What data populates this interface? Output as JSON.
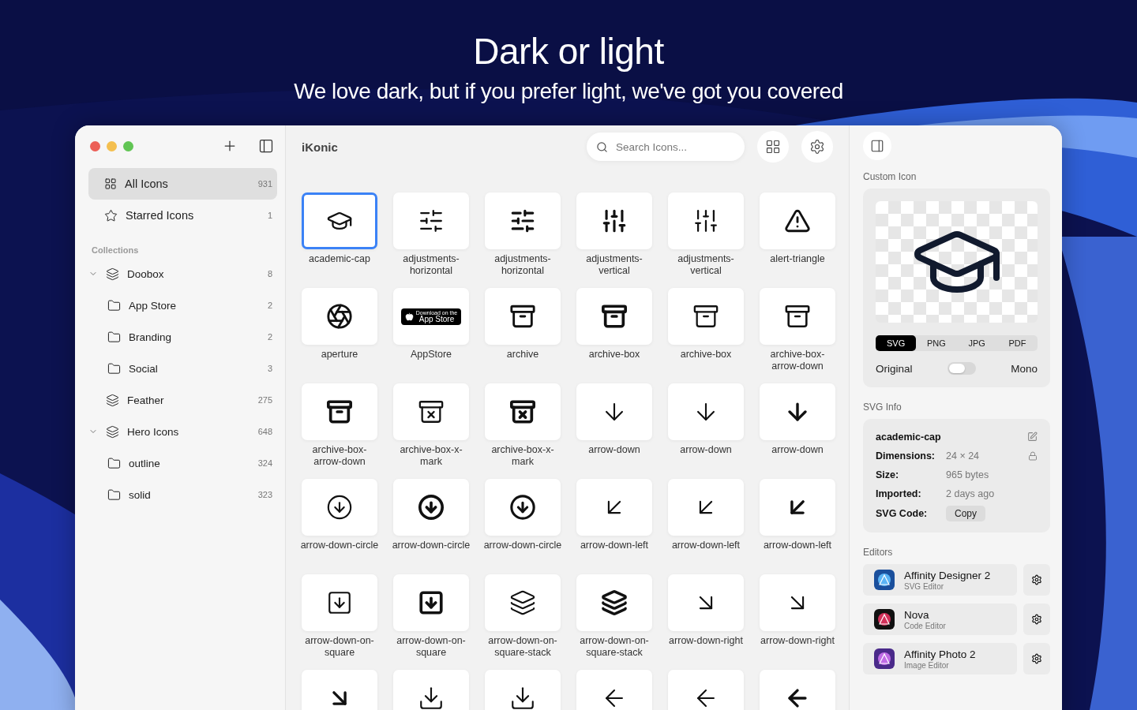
{
  "header": {
    "title": "Dark or light",
    "subtitle": "We love dark, but if you prefer light, we've got you covered"
  },
  "sidebar": {
    "items": [
      {
        "label": "All Icons",
        "count": "931",
        "selected": true,
        "kind": "grid"
      },
      {
        "label": "Starred Icons",
        "count": "1",
        "selected": false,
        "kind": "star"
      }
    ],
    "section_title": "Collections",
    "collections": [
      {
        "name": "Doobox",
        "count": "8",
        "expanded": true,
        "children": [
          {
            "name": "App Store",
            "count": "2"
          },
          {
            "name": "Branding",
            "count": "2"
          },
          {
            "name": "Social",
            "count": "3"
          }
        ]
      },
      {
        "name": "Feather",
        "count": "275"
      },
      {
        "name": "Hero Icons",
        "count": "648",
        "expanded": true,
        "children": [
          {
            "name": "outline",
            "count": "324"
          },
          {
            "name": "solid",
            "count": "323"
          }
        ]
      }
    ]
  },
  "main": {
    "title": "iKonic",
    "search": {
      "placeholder": "Search Icons..."
    },
    "icons": [
      {
        "label": "academic-cap",
        "selected": true
      },
      {
        "label": "adjustments-horizontal",
        "selected": false
      },
      {
        "label": "adjustments-horizontal",
        "selected": false
      },
      {
        "label": "adjustments-vertical",
        "selected": false
      },
      {
        "label": "adjustments-vertical",
        "selected": false
      },
      {
        "label": "alert-triangle",
        "selected": false
      },
      {
        "label": "aperture",
        "selected": false
      },
      {
        "label": "AppStore",
        "selected": false,
        "badge": {
          "small": "Download on the",
          "large": "App Store"
        }
      },
      {
        "label": "archive",
        "selected": false
      },
      {
        "label": "archive-box",
        "selected": false
      },
      {
        "label": "archive-box",
        "selected": false
      },
      {
        "label": "archive-box-arrow-down",
        "selected": false
      },
      {
        "label": "archive-box-arrow-down",
        "selected": false
      },
      {
        "label": "archive-box-x-mark",
        "selected": false
      },
      {
        "label": "archive-box-x-mark",
        "selected": false
      },
      {
        "label": "arrow-down",
        "selected": false
      },
      {
        "label": "arrow-down",
        "selected": false
      },
      {
        "label": "arrow-down",
        "selected": false
      },
      {
        "label": "arrow-down-circle",
        "selected": false
      },
      {
        "label": "arrow-down-circle",
        "selected": false
      },
      {
        "label": "arrow-down-circle",
        "selected": false
      },
      {
        "label": "arrow-down-left",
        "selected": false
      },
      {
        "label": "arrow-down-left",
        "selected": false
      },
      {
        "label": "arrow-down-left",
        "selected": false
      },
      {
        "label": "arrow-down-on-square",
        "selected": false
      },
      {
        "label": "arrow-down-on-square",
        "selected": false
      },
      {
        "label": "arrow-down-on-square-stack",
        "selected": false
      },
      {
        "label": "arrow-down-on-square-stack",
        "selected": false
      },
      {
        "label": "arrow-down-right",
        "selected": false
      },
      {
        "label": "arrow-down-right",
        "selected": false
      },
      {
        "selected": false
      },
      {
        "selected": false
      },
      {
        "selected": false
      },
      {
        "selected": false
      },
      {
        "selected": false
      },
      {
        "selected": false
      }
    ]
  },
  "inspector": {
    "preview_title": "Custom Icon",
    "formats": [
      {
        "label": "SVG",
        "selected": true
      },
      {
        "label": "PNG",
        "selected": false
      },
      {
        "label": "JPG",
        "selected": false
      },
      {
        "label": "PDF",
        "selected": false
      }
    ],
    "mode": {
      "left_label": "Original",
      "right_label": "Mono",
      "on": false
    },
    "info_title": "SVG Info",
    "info": {
      "name": "academic-cap",
      "rows": [
        {
          "label": "Dimensions:",
          "value": "24 × 24",
          "kind": "text"
        },
        {
          "label": "Size:",
          "value": "965 bytes",
          "kind": "text"
        },
        {
          "label": "Imported:",
          "value": "2 days ago",
          "kind": "text"
        },
        {
          "label": "SVG Code:",
          "value": "Copy",
          "kind": "button"
        }
      ]
    },
    "editors_title": "Editors",
    "editors": [
      {
        "name": "Affinity Designer 2",
        "role": "SVG Editor"
      },
      {
        "name": "Nova",
        "role": "Code Editor"
      },
      {
        "name": "Affinity Photo 2",
        "role": "Image Editor"
      }
    ]
  }
}
